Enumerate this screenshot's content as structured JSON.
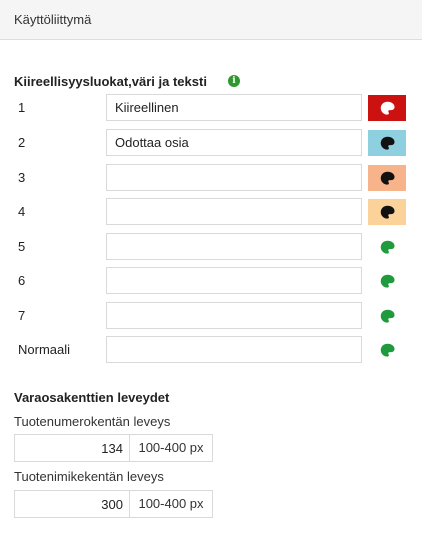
{
  "panel": {
    "title": "Käyttöliittymä"
  },
  "priority": {
    "title": "Kiireellisyysluokat,väri ja teksti",
    "info_icon": "info-circle-icon",
    "rows": [
      {
        "label": "1",
        "value": "Kiireellinen",
        "color": "#cc1111",
        "icon_color": "#ffffff"
      },
      {
        "label": "2",
        "value": "Odottaa osia",
        "color": "#8ecfe0",
        "icon_color": "#111111"
      },
      {
        "label": "3",
        "value": "",
        "color": "#f7b38a",
        "icon_color": "#111111"
      },
      {
        "label": "4",
        "value": "",
        "color": "#fbd39a",
        "icon_color": "#111111"
      },
      {
        "label": "5",
        "value": "",
        "color": "",
        "icon_color": "#1f9a3c"
      },
      {
        "label": "6",
        "value": "",
        "color": "",
        "icon_color": "#1f9a3c"
      },
      {
        "label": "7",
        "value": "",
        "color": "",
        "icon_color": "#1f9a3c"
      },
      {
        "label": "Normaali",
        "value": "",
        "color": "",
        "icon_color": "#1f9a3c"
      }
    ]
  },
  "widths": {
    "title": "Varaosakenttien leveydet",
    "product_number": {
      "label": "Tuotenumerokentän leveys",
      "value": "134",
      "unit": "100-400 px"
    },
    "product_name": {
      "label": "Tuotenimikekentän leveys",
      "value": "300",
      "unit": "100-400 px"
    }
  }
}
